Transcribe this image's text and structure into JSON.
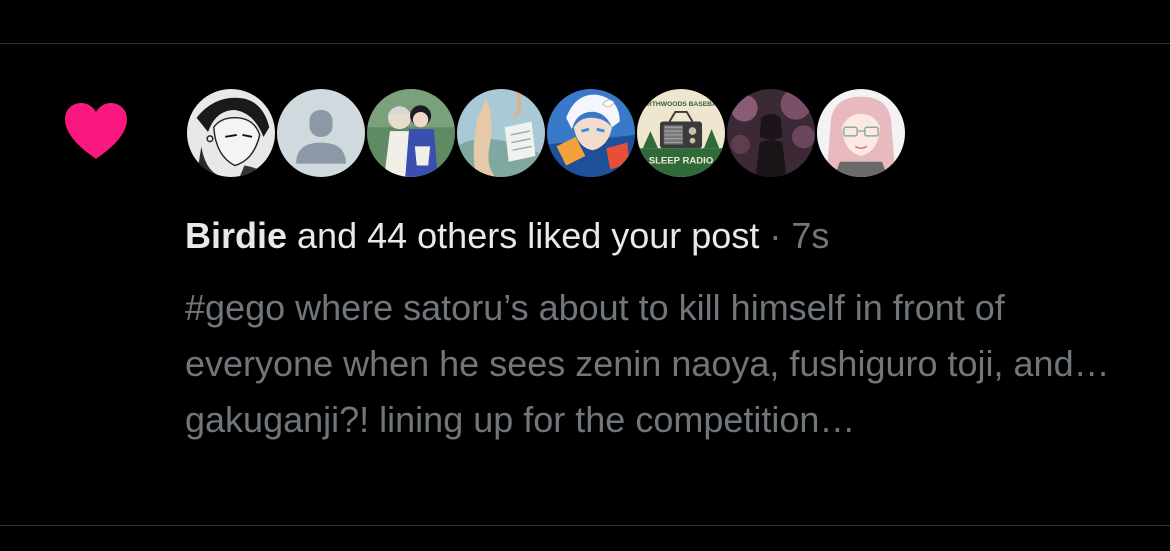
{
  "notification": {
    "type": "like",
    "icon": "heart-icon",
    "icon_color": "#f91880",
    "avatars": [
      {
        "name": "avatar-1",
        "icon": "anime-man-sketch-avatar"
      },
      {
        "name": "avatar-2",
        "icon": "default-person-avatar"
      },
      {
        "name": "avatar-3",
        "icon": "illustrated-couple-avatar"
      },
      {
        "name": "avatar-4",
        "icon": "painted-figure-avatar"
      },
      {
        "name": "avatar-5",
        "icon": "anime-white-hair-avatar"
      },
      {
        "name": "avatar-6",
        "icon": "northwoods-baseball-sleep-radio-avatar",
        "text_top": "NORTHWOODS BASEBALL",
        "text_bottom": "SLEEP RADIO"
      },
      {
        "name": "avatar-7",
        "icon": "dim-photo-figure-avatar"
      },
      {
        "name": "avatar-8",
        "icon": "pink-hair-glasses-avatar"
      }
    ],
    "summary": {
      "name": "Birdie",
      "rest": " and 44 others liked your post",
      "separator": " · ",
      "time": "7s"
    },
    "post_text": "#gego where satoru’s about to kill himself in front of everyone when he sees zenin naoya, fushiguro toji, and… gakuganji?! lining up for the competition…"
  },
  "colors": {
    "background": "#000000",
    "primary_text": "#e7e9ea",
    "secondary_text": "#71767b",
    "divider": "#2f3336",
    "like": "#f91880"
  }
}
